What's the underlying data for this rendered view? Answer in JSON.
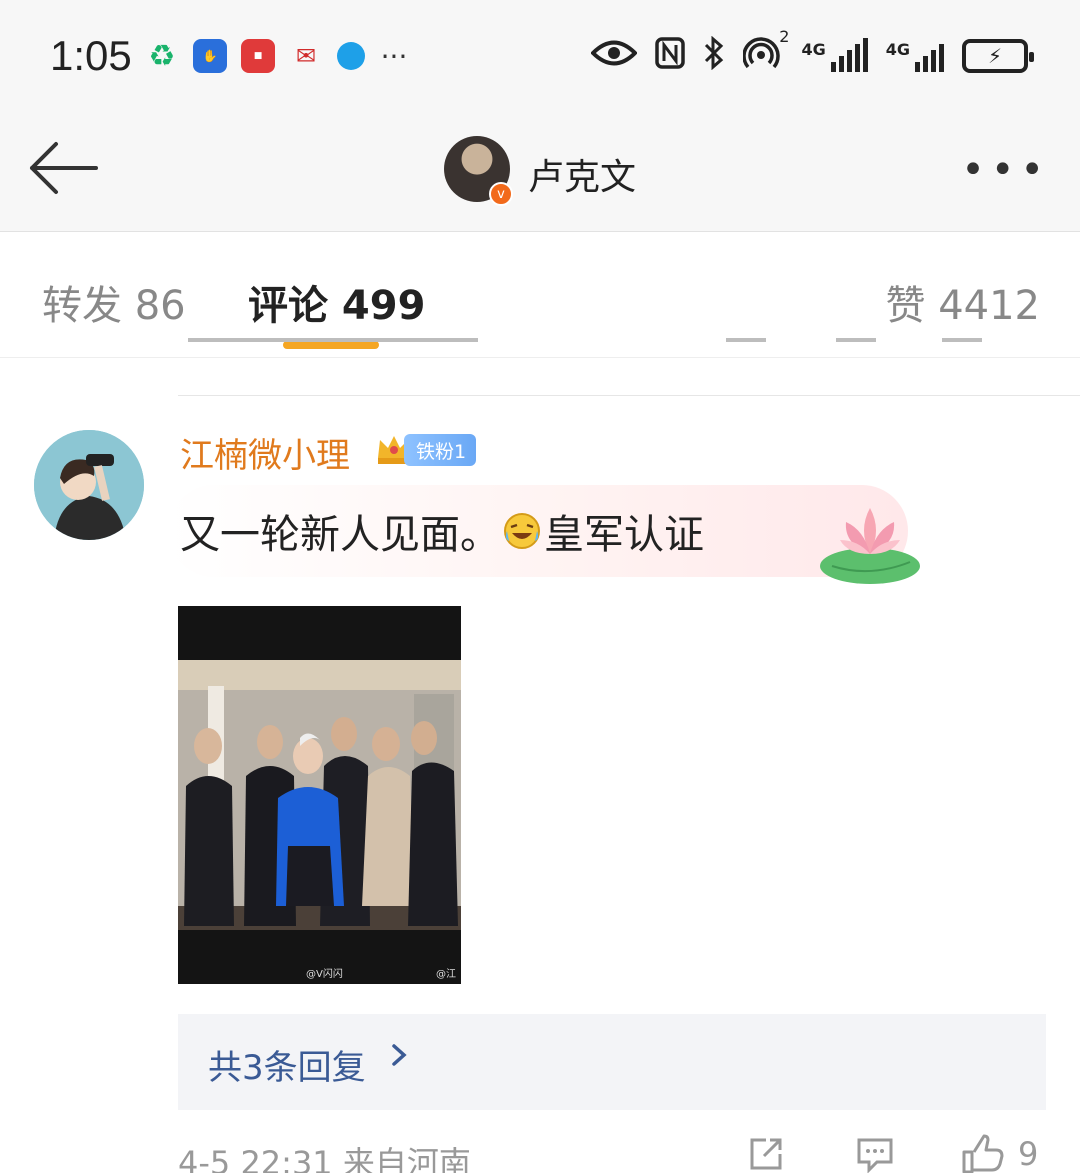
{
  "status_bar": {
    "time": "1:05",
    "network_1": "4G",
    "network_2": "4G",
    "sim_badge": "2"
  },
  "header": {
    "name": "卢克文"
  },
  "tabs": [
    {
      "label": "转发 86"
    },
    {
      "label": "评论 499"
    },
    {
      "label": "赞 4412"
    }
  ],
  "comment": {
    "user": "江楠微小理",
    "fan_badge": "铁粉1",
    "text_before_emoji": "又一轮新人见面。",
    "text_after_emoji": "皇军认证",
    "photo_watermarks": [
      "@V闪闪",
      "@江"
    ],
    "replies_label": "共3条回复",
    "timestamp": "4-5 22:31 来自河南",
    "like_count": "9"
  },
  "colors": {
    "accent": "#f5a623",
    "username": "#e07a1d",
    "link": "#3a5a95"
  }
}
